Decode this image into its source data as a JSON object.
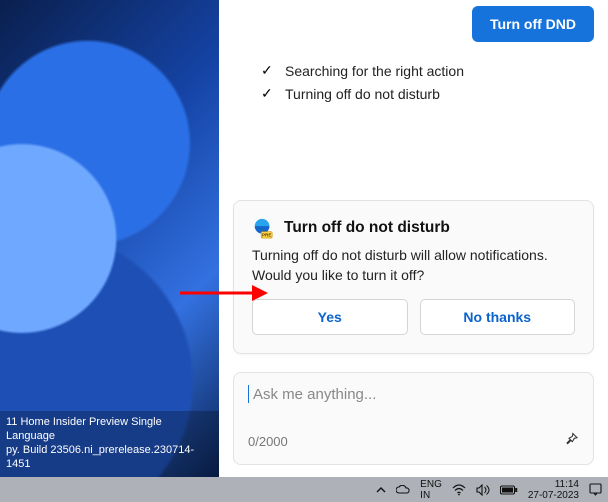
{
  "desktop": {
    "build_line1": "11 Home Insider Preview Single Language",
    "build_line2": "py. Build 23506.ni_prerelease.230714-1451"
  },
  "panel": {
    "primary_button": "Turn off DND",
    "status": [
      "Searching for the right action",
      "Turning off do not disturb"
    ]
  },
  "card": {
    "title": "Turn off do not disturb",
    "body": "Turning off do not disturb will allow notifications. Would you like to turn it off?",
    "yes": "Yes",
    "no": "No thanks"
  },
  "input": {
    "placeholder": "Ask me anything...",
    "value": "",
    "counter": "0/2000"
  },
  "taskbar": {
    "lang_top": "ENG",
    "lang_bottom": "IN",
    "time": "11:14",
    "date": "27-07-2023"
  }
}
